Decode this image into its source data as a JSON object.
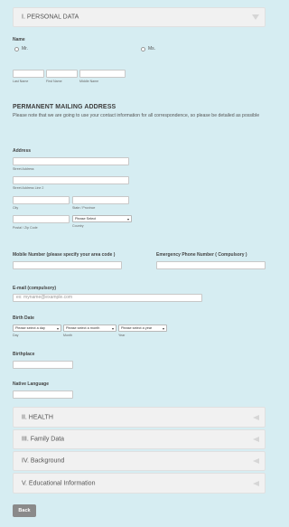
{
  "sections": {
    "personal": "I. PERSONAL DATA",
    "health": "II. HEALTH",
    "family": "III. Family Data",
    "background": "IV. Background",
    "education": "V. Educational Information"
  },
  "name": {
    "label": "Name",
    "mr": "Mr.",
    "ms": "Ms.",
    "last": "Last Name",
    "first": "First Name",
    "middle": "Middle Name"
  },
  "mailing": {
    "title": "PERMANENT MAILING ADDRESS",
    "note": "Please note that we are going to use your contact information for all correspondence, so please be detailed as possible"
  },
  "address": {
    "label": "Address",
    "street": "Street Address",
    "street2": "Street Address Line 2",
    "city": "City",
    "state": "State / Province",
    "postal": "Postal / Zip Code",
    "country": "Country",
    "country_select": "Please Select"
  },
  "phones": {
    "mobile": "Mobile Number (please specify your area code )",
    "emergency": "Emergency Phone Number ( Compulsory )"
  },
  "email": {
    "label": "E-mail (compulsory)",
    "placeholder": "ex: myname@example.com"
  },
  "birth": {
    "label": "Birth Date",
    "day_select": "Please select a day",
    "month_select": "Please select a month",
    "year_select": "Please select a year",
    "day": "Day",
    "month": "Month",
    "year": "Year"
  },
  "birthplace": {
    "label": "Birthplace"
  },
  "language": {
    "label": "Native Language"
  },
  "back_button": "Back",
  "icons": {
    "expand": "chevron-down-icon",
    "collapse": "chevron-left-icon",
    "select": "dropdown-caret-icon"
  }
}
